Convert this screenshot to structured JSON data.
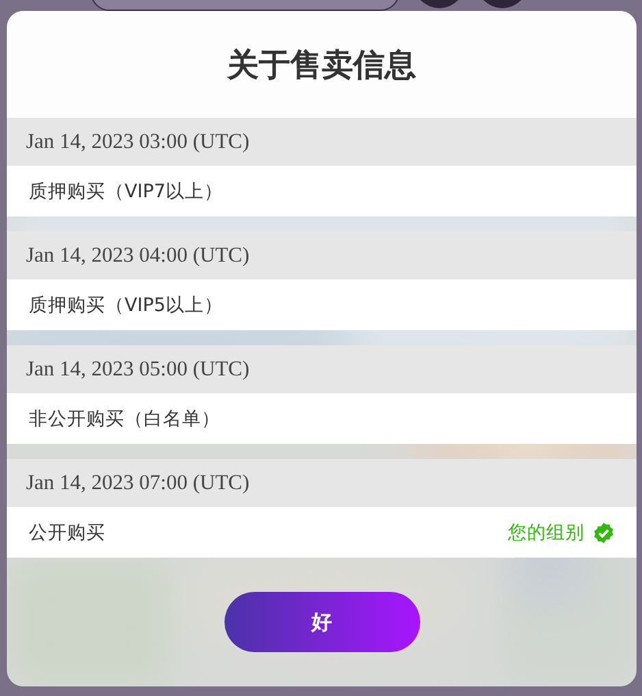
{
  "dialog": {
    "title": "关于售卖信息",
    "sales": [
      {
        "time": "Jan 14, 2023 03:00 (UTC)",
        "label": "质押购买（VIP7以上）"
      },
      {
        "time": "Jan 14, 2023 04:00 (UTC)",
        "label": "质押购买（VIP5以上）"
      },
      {
        "time": "Jan 14, 2023 05:00 (UTC)",
        "label": "非公开购买（白名单）"
      },
      {
        "time": "Jan 14, 2023 07:00 (UTC)",
        "label": "公开购买",
        "note": "您的组别"
      }
    ],
    "button": "好"
  }
}
